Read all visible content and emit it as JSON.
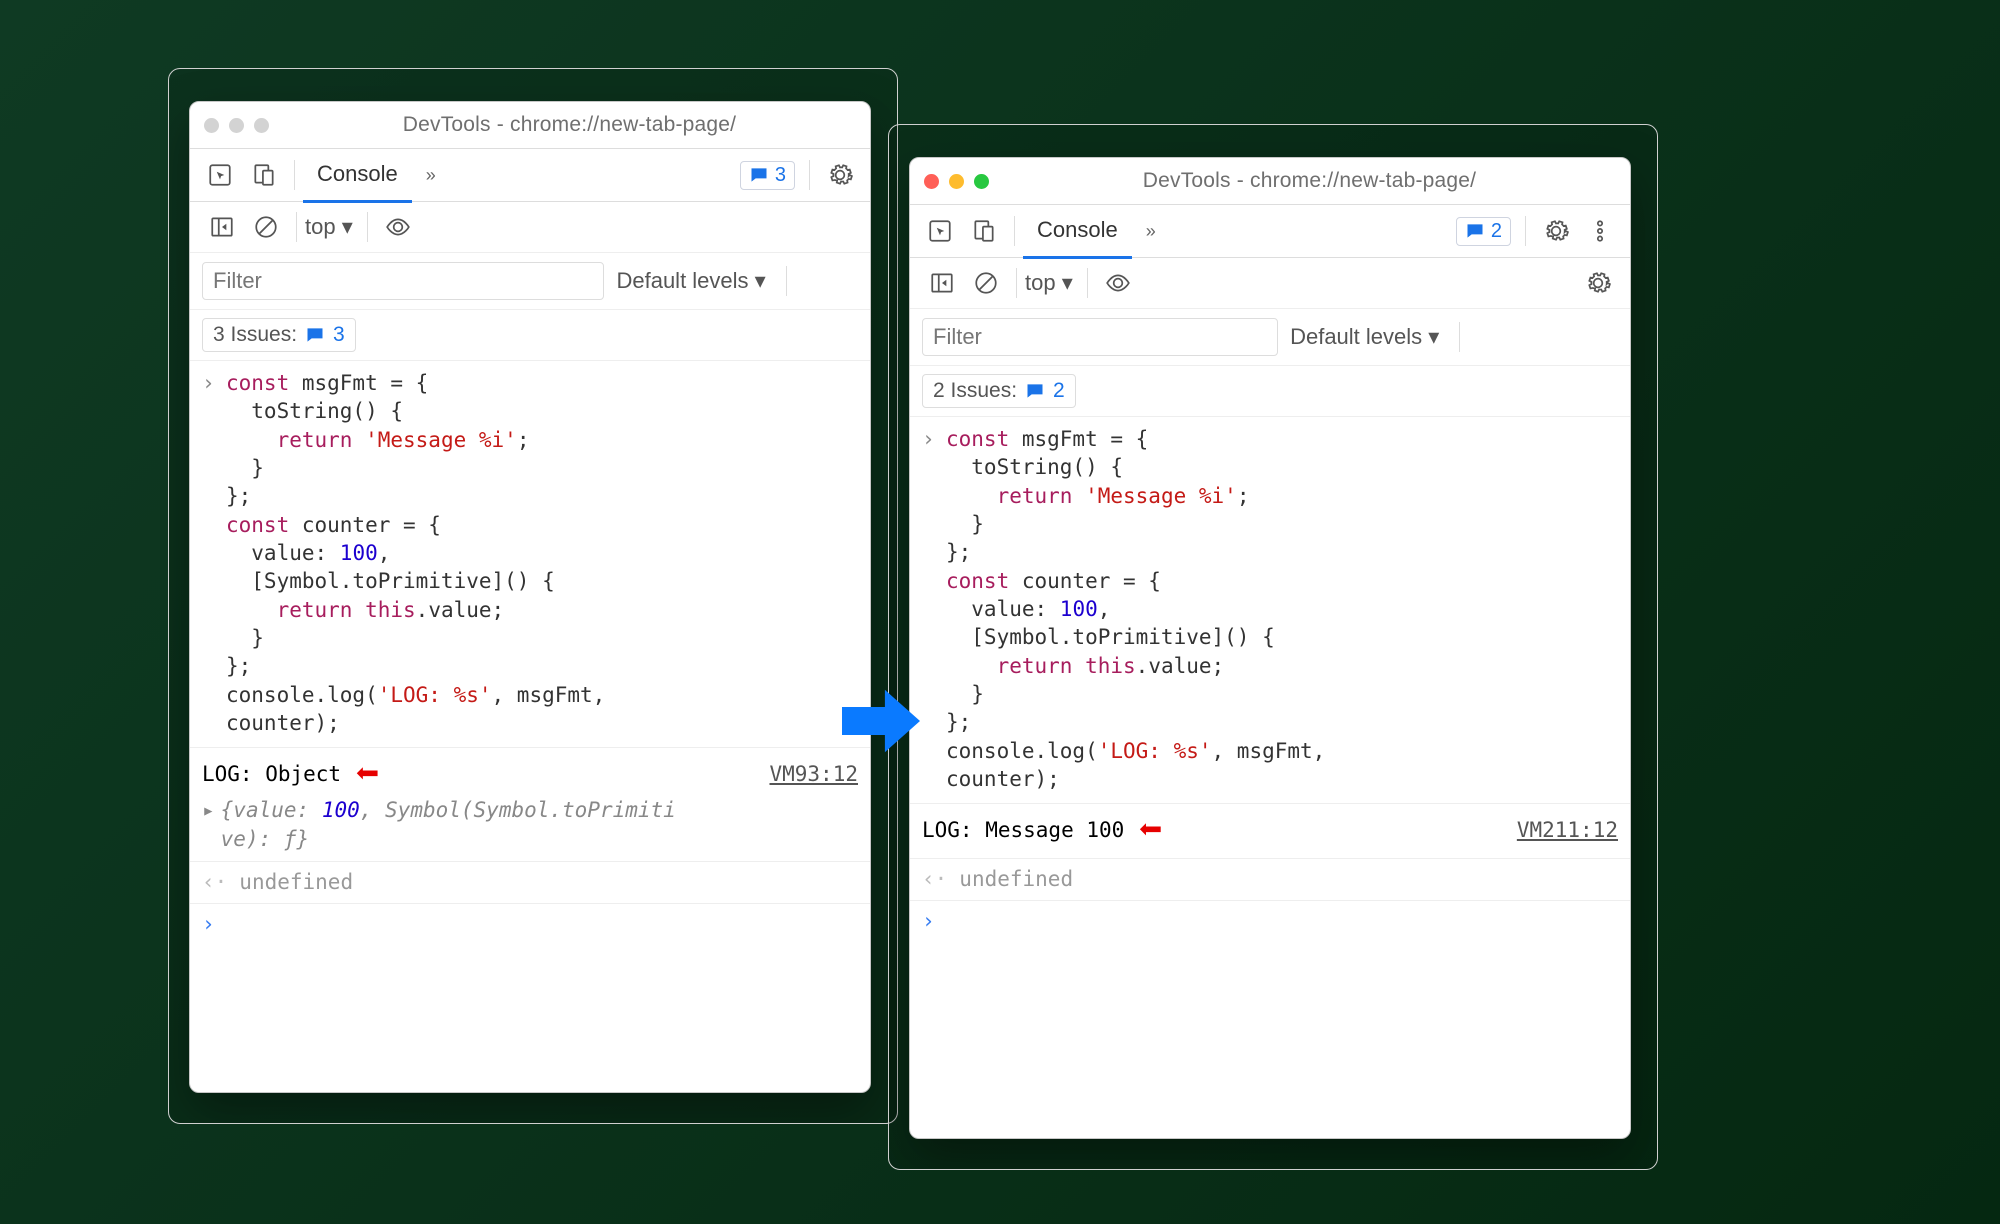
{
  "left": {
    "title": "DevTools - chrome://new-tab-page/",
    "tabs": {
      "console": "Console"
    },
    "issuesChipCount": "3",
    "context": "top",
    "filterPlaceholder": "Filter",
    "levels": "Default levels",
    "issuesLabel": "3 Issues:",
    "issuesCount": "3",
    "code": {
      "l1": "const msgFmt = {",
      "l2": "  toString() {",
      "l3": "    return 'Message %i';",
      "l4": "  }",
      "l5": "};",
      "l6": "const counter = {",
      "l7": "  value: 100,",
      "l8": "  [Symbol.toPrimitive]() {",
      "l9": "    return this.value;",
      "l10": "  }",
      "l11": "};",
      "l12a": "console.log('LOG: %s', msgFmt,",
      "l12b": "counter);"
    },
    "output": {
      "line": "LOG: Object",
      "source": "VM93:12",
      "preview": "{value: 100, Symbol(Symbol.toPrimitive): ƒ}"
    },
    "return": "undefined"
  },
  "right": {
    "title": "DevTools - chrome://new-tab-page/",
    "tabs": {
      "console": "Console"
    },
    "issuesChipCount": "2",
    "context": "top",
    "filterPlaceholder": "Filter",
    "levels": "Default levels",
    "issuesLabel": "2 Issues:",
    "issuesCount": "2",
    "code": {
      "l1": "const msgFmt = {",
      "l2": "  toString() {",
      "l3": "    return 'Message %i';",
      "l4": "  }",
      "l5": "};",
      "l6": "const counter = {",
      "l7": "  value: 100,",
      "l8": "  [Symbol.toPrimitive]() {",
      "l9": "    return this.value;",
      "l10": "  }",
      "l11": "};",
      "l12a": "console.log('LOG: %s', msgFmt,",
      "l12b": "counter);"
    },
    "output": {
      "line": "LOG: Message 100",
      "source": "VM211:12"
    },
    "return": "undefined"
  }
}
